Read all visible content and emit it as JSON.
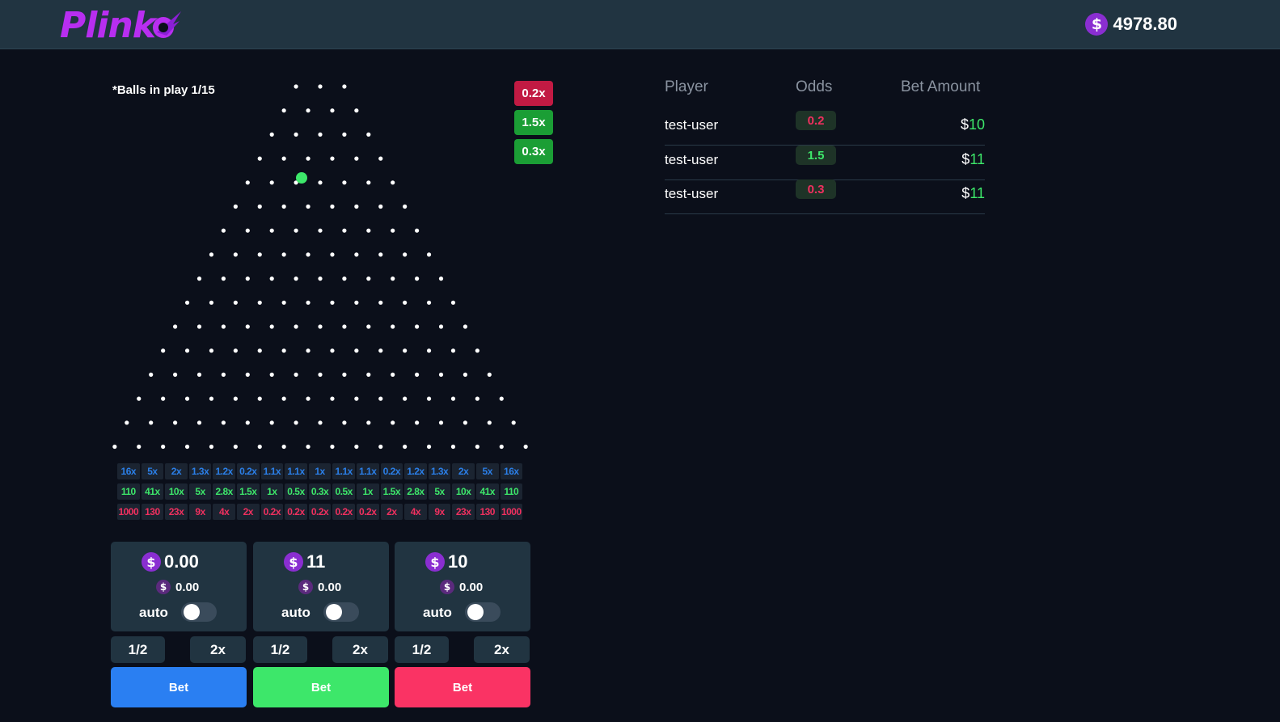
{
  "header": {
    "logo_text": "Plink",
    "balance": "4978.80",
    "coin_symbol": "$"
  },
  "game": {
    "balls_in_play": "*Balls in play 1/15",
    "peg_rows": 16,
    "recent_results": [
      {
        "label": "0.2x",
        "color": "#c21a43"
      },
      {
        "label": "1.5x",
        "color": "#1b9e35"
      },
      {
        "label": "0.3x",
        "color": "#1b9e35"
      }
    ],
    "multiplier_rows": [
      {
        "color": "#2b7fe8",
        "values": [
          "16x",
          "5x",
          "2x",
          "1.3x",
          "1.2x",
          "0.2x",
          "1.1x",
          "1.1x",
          "1x",
          "1.1x",
          "1.1x",
          "0.2x",
          "1.2x",
          "1.3x",
          "2x",
          "5x",
          "16x"
        ]
      },
      {
        "color": "#3de76a",
        "values": [
          "110",
          "41x",
          "10x",
          "5x",
          "2.8x",
          "1.5x",
          "1x",
          "0.5x",
          "0.3x",
          "0.5x",
          "1x",
          "1.5x",
          "2.8x",
          "5x",
          "10x",
          "41x",
          "110"
        ]
      },
      {
        "color": "#f0305f",
        "values": [
          "1000",
          "130",
          "23x",
          "9x",
          "4x",
          "2x",
          "0.2x",
          "0.2x",
          "0.2x",
          "0.2x",
          "0.2x",
          "2x",
          "4x",
          "9x",
          "23x",
          "130",
          "1000"
        ]
      }
    ]
  },
  "bet_panels": [
    {
      "amount": "0.00",
      "profit": "0.00",
      "auto_label": "auto",
      "half_label": "1/2",
      "double_label": "2x",
      "bet_label": "Bet",
      "bet_color": "#2a7ff2"
    },
    {
      "amount": "11",
      "profit": "0.00",
      "auto_label": "auto",
      "half_label": "1/2",
      "double_label": "2x",
      "bet_label": "Bet",
      "bet_color": "#3de76a"
    },
    {
      "amount": "10",
      "profit": "0.00",
      "auto_label": "auto",
      "half_label": "1/2",
      "double_label": "2x",
      "bet_label": "Bet",
      "bet_color": "#fa3364"
    }
  ],
  "bets_table": {
    "headers": {
      "player": "Player",
      "odds": "Odds",
      "bet_amount": "Bet Amount"
    },
    "rows": [
      {
        "player": "test-user",
        "odds": "0.2",
        "odds_color": "#f0305f",
        "currency": "$",
        "amount": "10"
      },
      {
        "player": "test-user",
        "odds": "1.5",
        "odds_color": "#3de76a",
        "currency": "$",
        "amount": "11"
      },
      {
        "player": "test-user",
        "odds": "0.3",
        "odds_color": "#f0305f",
        "currency": "$",
        "amount": "11"
      }
    ]
  },
  "colors": {
    "background": "#0b0f1a",
    "header": "#213441",
    "brand": "#b82ef0",
    "ball": "#3de76a"
  }
}
